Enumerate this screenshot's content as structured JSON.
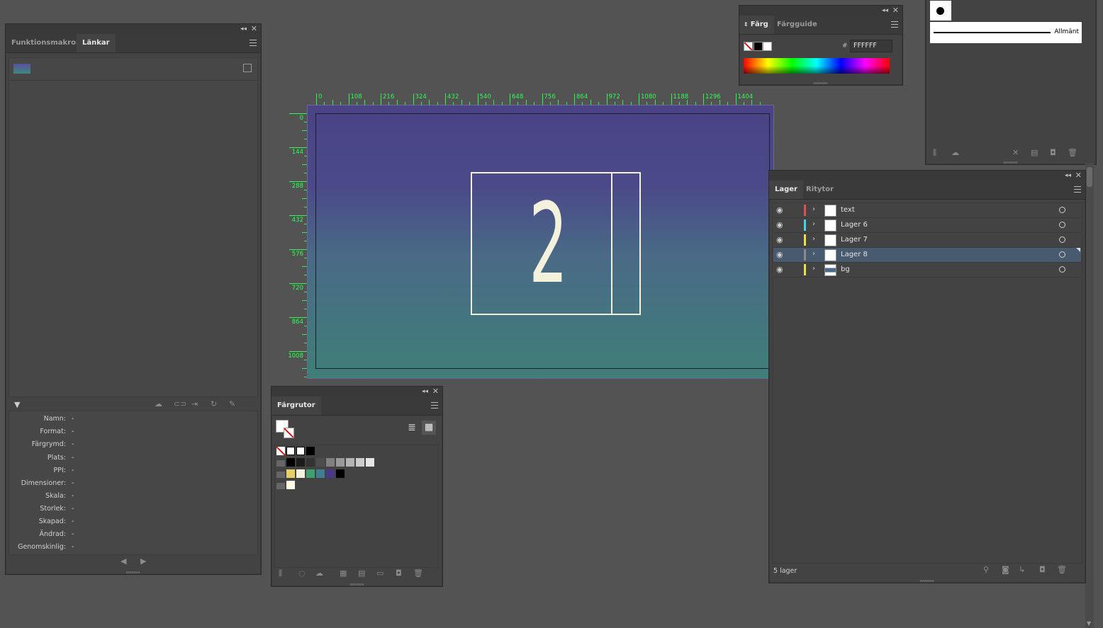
{
  "links_panel": {
    "tabs": [
      "Funktionsmakron",
      "Länkar"
    ],
    "info_rows": [
      {
        "label": "Namn:",
        "value": "-"
      },
      {
        "label": "Format:",
        "value": "-"
      },
      {
        "label": "Färgrymd:",
        "value": "-"
      },
      {
        "label": "Plats:",
        "value": "-"
      },
      {
        "label": "PPI:",
        "value": "-"
      },
      {
        "label": "Dimensioner:",
        "value": "-"
      },
      {
        "label": "Skala:",
        "value": "-"
      },
      {
        "label": "Storlek:",
        "value": "-"
      },
      {
        "label": "Skapad:",
        "value": "-"
      },
      {
        "label": "Ändrad:",
        "value": "-"
      },
      {
        "label": "Genomskinlig:",
        "value": "-"
      }
    ]
  },
  "color_panel": {
    "tabs": [
      "Färg",
      "Färgguide"
    ],
    "hex_label": "#",
    "hex_value": "FFFFFF"
  },
  "brush_panel": {
    "label": "Allmänt"
  },
  "layers_panel": {
    "tabs": [
      "Lager",
      "Ritytor"
    ],
    "layers": [
      {
        "name": "text",
        "color": "#e05050",
        "selected": false
      },
      {
        "name": "Lager 6",
        "color": "#4fd0e0",
        "selected": false
      },
      {
        "name": "Lager 7",
        "color": "#e8e050",
        "selected": false
      },
      {
        "name": "Lager 8",
        "color": "#8a8a8a",
        "selected": true
      },
      {
        "name": "bg",
        "color": "#e8e050",
        "selected": false
      }
    ],
    "count_label": "5 lager"
  },
  "swatches_panel": {
    "title": "Färgrutor"
  },
  "canvas": {
    "number": "2",
    "ruler_h": [
      "0",
      "108",
      "216",
      "324",
      "432",
      "540",
      "648",
      "756",
      "864",
      "972",
      "1080",
      "1188",
      "1296",
      "1404"
    ],
    "ruler_v": [
      "0",
      "144",
      "288",
      "432",
      "576",
      "720",
      "864",
      "1008"
    ]
  },
  "colors": {
    "ui_bg": "#535353",
    "panel_bg": "#434343",
    "ruler_green": "#2dff55",
    "art_top": "#4a4386",
    "art_bottom": "#3f7f78",
    "cream": "#f4f1dc"
  }
}
